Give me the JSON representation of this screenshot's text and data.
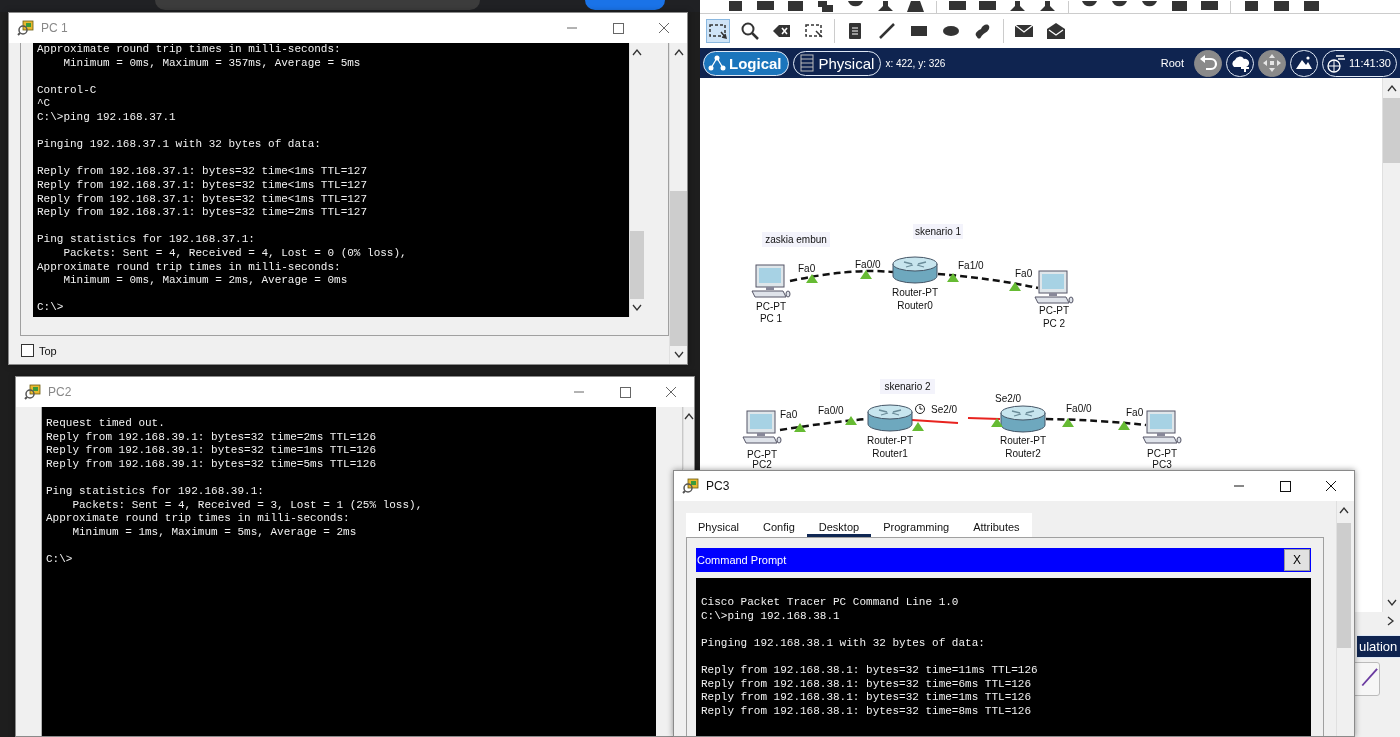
{
  "pc1_window": {
    "title": "PC 1",
    "active": false,
    "terminal_blocks": [
      [
        "Approximate round trip times in milli-seconds:",
        "    Minimum = 0ms, Maximum = 357ms, Average = 5ms"
      ],
      [
        "Control-C",
        "^C",
        "C:\\>ping 192.168.37.1"
      ],
      [
        "Pinging 192.168.37.1 with 32 bytes of data:"
      ],
      [
        "Reply from 192.168.37.1: bytes=32 time<1ms TTL=127",
        "Reply from 192.168.37.1: bytes=32 time<1ms TTL=127",
        "Reply from 192.168.37.1: bytes=32 time<1ms TTL=127",
        "Reply from 192.168.37.1: bytes=32 time=2ms TTL=127"
      ],
      [
        "Ping statistics for 192.168.37.1:",
        "    Packets: Sent = 4, Received = 4, Lost = 0 (0% loss),",
        "Approximate round trip times in milli-seconds:",
        "    Minimum = 0ms, Maximum = 2ms, Average = 0ms"
      ],
      [
        "C:\\>"
      ]
    ],
    "top_checkbox": {
      "label": "Top",
      "checked": false
    }
  },
  "pc2_window": {
    "title": "PC2",
    "active": false,
    "terminal_blocks": [
      [
        "Request timed out.",
        "Reply from 192.168.39.1: bytes=32 time=2ms TTL=126",
        "Reply from 192.168.39.1: bytes=32 time=1ms TTL=126",
        "Reply from 192.168.39.1: bytes=32 time=5ms TTL=126"
      ],
      [
        "Ping statistics for 192.168.39.1:",
        "    Packets: Sent = 4, Received = 3, Lost = 1 (25% loss),",
        "Approximate round trip times in milli-seconds:",
        "    Minimum = 1ms, Maximum = 5ms, Average = 2ms"
      ],
      [
        "C:\\>"
      ]
    ]
  },
  "packet_tracer": {
    "tools": [
      {
        "kind": "select",
        "selected": true
      },
      {
        "kind": "inspect",
        "selected": false
      },
      {
        "kind": "delete",
        "selected": false
      },
      {
        "kind": "resize",
        "selected": false
      },
      {
        "kind": "note",
        "selected": false
      },
      {
        "kind": "line",
        "selected": false
      },
      {
        "kind": "rectangle",
        "selected": false
      },
      {
        "kind": "ellipse",
        "selected": false
      },
      {
        "kind": "freeform",
        "selected": false
      },
      {
        "kind": "simple-pdu",
        "selected": false
      },
      {
        "kind": "complex-pdu",
        "selected": false
      }
    ],
    "view_tabs": [
      {
        "label": "Logical",
        "selected": true
      },
      {
        "label": "Physical",
        "selected": false
      }
    ],
    "coordinates": "x: 422, y: 326",
    "root_label": "Root",
    "clock": "11:41:30",
    "notes": [
      "zaskia embun",
      "skenario 1",
      "skenario 2"
    ],
    "devices": [
      {
        "kind": "pc",
        "model": "PC-PT",
        "name": "PC 1"
      },
      {
        "kind": "router",
        "model": "Router-PT",
        "name": "Router0"
      },
      {
        "kind": "pc",
        "model": "PC-PT",
        "name": "PC 2"
      },
      {
        "kind": "pc",
        "model": "PC-PT",
        "name": "PC2"
      },
      {
        "kind": "router",
        "model": "Router-PT",
        "name": "Router1"
      },
      {
        "kind": "router",
        "model": "Router-PT",
        "name": "Router2"
      },
      {
        "kind": "pc",
        "model": "PC-PT",
        "name": "PC3"
      }
    ],
    "links": [
      {
        "kind": "copper",
        "ends": [
          {
            "port": "Fa0",
            "up": true
          },
          {
            "port": "Fa0/0",
            "up": true
          }
        ]
      },
      {
        "kind": "copper",
        "ends": [
          {
            "port": "Fa1/0",
            "up": true
          },
          {
            "port": "Fa0",
            "up": true
          }
        ]
      },
      {
        "kind": "copper",
        "ends": [
          {
            "port": "Fa0",
            "up": true
          },
          {
            "port": "Fa0/0",
            "up": true
          }
        ]
      },
      {
        "kind": "serial",
        "clock": true,
        "ends": [
          {
            "port": "Se2/0",
            "up": true
          },
          {
            "port": "Se2/0",
            "up": true
          }
        ]
      },
      {
        "kind": "copper",
        "ends": [
          {
            "port": "Fa0/0",
            "up": true
          },
          {
            "port": "Fa0",
            "up": true
          }
        ]
      }
    ],
    "simulation_button": "ulation"
  },
  "pc3_window": {
    "title": "PC3",
    "active": true,
    "tabs": [
      {
        "label": "Physical",
        "selected": false
      },
      {
        "label": "Config",
        "selected": false
      },
      {
        "label": "Desktop",
        "selected": true
      },
      {
        "label": "Programming",
        "selected": false
      },
      {
        "label": "Attributes",
        "selected": false
      }
    ],
    "command_prompt": {
      "title": "Command Prompt",
      "close_label": "X",
      "terminal_blocks": [
        [
          "Cisco Packet Tracer PC Command Line 1.0",
          "C:\\>ping 192.168.38.1"
        ],
        [
          "Pinging 192.168.38.1 with 32 bytes of data:"
        ],
        [
          "Reply from 192.168.38.1: bytes=32 time=11ms TTL=126",
          "Reply from 192.168.38.1: bytes=32 time=6ms TTL=126",
          "Reply from 192.168.38.1: bytes=32 time=1ms TTL=126",
          "Reply from 192.168.38.1: bytes=32 time=8ms TTL=126"
        ]
      ]
    }
  }
}
